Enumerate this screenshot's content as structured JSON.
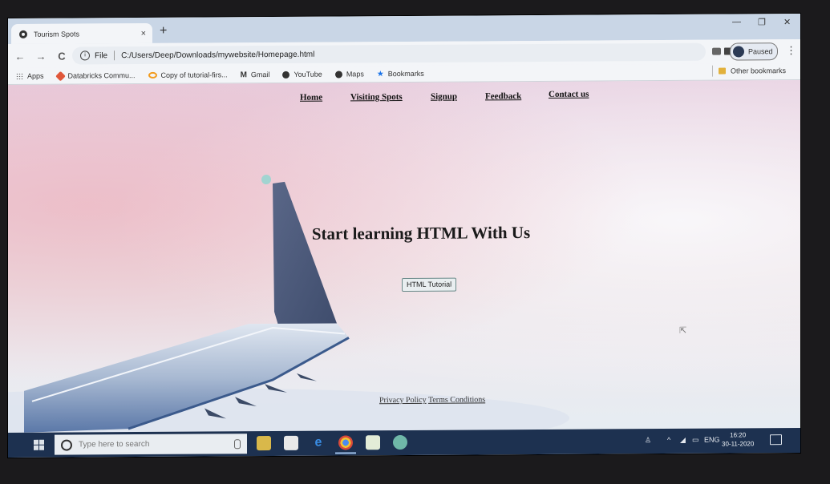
{
  "browser": {
    "tab_title": "Tourism Spots",
    "tab_close": "×",
    "new_tab": "+",
    "window_minimize": "—",
    "window_restore": "❐",
    "window_close": "✕",
    "nav_back": "←",
    "nav_forward": "→",
    "nav_reload": "C",
    "address_scheme": "File",
    "address_url": "C:/Users/Deep/Downloads/mywebsite/Homepage.html",
    "star": "☆",
    "profile_status": "Paused",
    "menu": "⋮",
    "bookmarks": [
      {
        "label": "Apps",
        "icon": "apps-grid-icon",
        "color": "#555555"
      },
      {
        "label": "Databricks Commu...",
        "icon": "databricks-icon",
        "color": "#e0573a"
      },
      {
        "label": "Copy of tutorial-firs...",
        "icon": "colab-icon",
        "color": "#f29b1d"
      },
      {
        "label": "Gmail",
        "icon": "gmail-icon",
        "color": "#d44638"
      },
      {
        "label": "YouTube",
        "icon": "globe-icon",
        "color": "#333333"
      },
      {
        "label": "Maps",
        "icon": "globe-icon",
        "color": "#333333"
      },
      {
        "label": "Bookmarks",
        "icon": "star-icon",
        "color": "#1a73e8"
      }
    ],
    "other_bookmarks": "Other bookmarks"
  },
  "page": {
    "nav": {
      "home": "Home",
      "visiting_spots": "Visiting Spots",
      "signup": "Signup",
      "feedback": "Feedback",
      "contact": "Contact us"
    },
    "hero_title": "Start learning HTML With Us",
    "hero_button": "HTML Tutorial",
    "footer": {
      "privacy": "Privacy Policy",
      "terms": "Terms Conditions"
    }
  },
  "taskbar": {
    "search_placeholder": "Type here to search",
    "language": "ENG",
    "time": "16:20",
    "date": "30-11-2020"
  },
  "colors": {
    "taskbar": "#1d3150",
    "tab_strip": "#c9d6e6"
  }
}
